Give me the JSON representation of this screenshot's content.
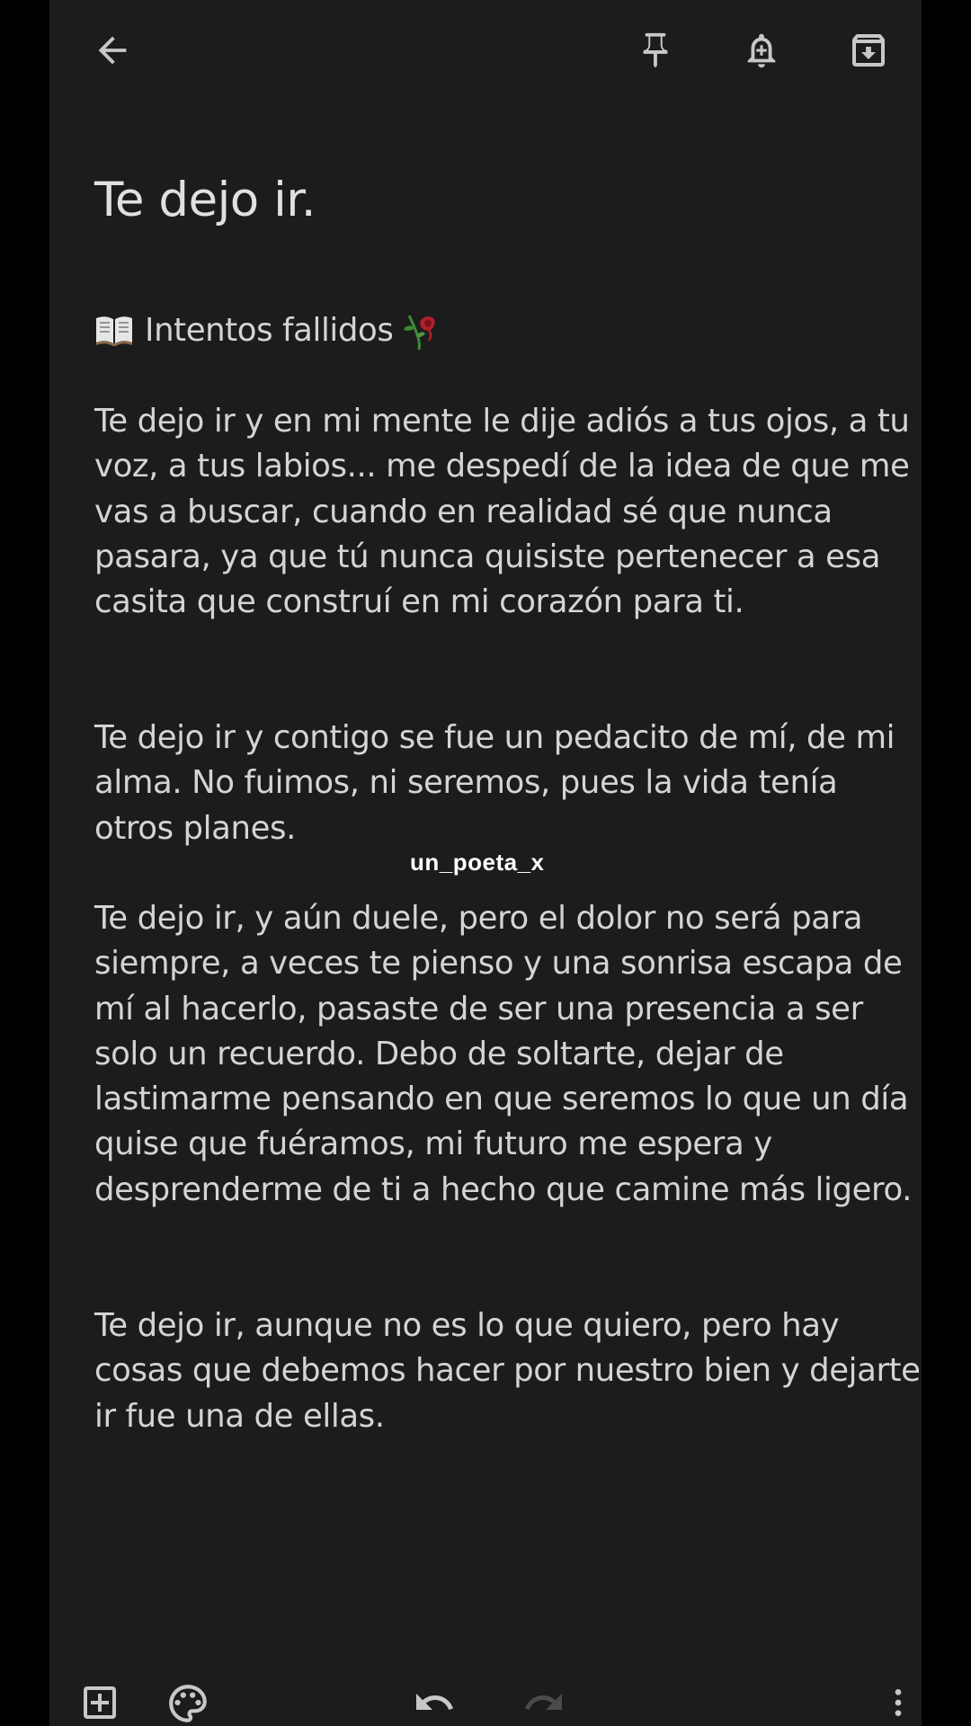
{
  "note": {
    "title": "Te dejo ir.",
    "subtitle": "Intentos fallidos",
    "paragraphs": [
      "Te dejo ir y en mi mente le dije adiós a tus ojos, a tu voz, a tus labios... me despedí de la idea de que me vas a buscar, cuando en realidad sé que nunca pasara, ya que tú nunca quisiste pertenecer a esa casita que construí en mi corazón para ti.",
      "Te dejo ir y contigo se fue un pedacito de mí, de mi alma. No fuimos, ni seremos, pues la vida tenía otros planes.",
      "Te dejo ir, y aún duele, pero el dolor no será para siempre, a veces te pienso y una sonrisa escapa de mí al hacerlo, pasaste de ser una presencia a ser solo un recuerdo. Debo de soltarte, dejar de lastimarme pensando en que seremos lo que un día quise que fuéramos, mi futuro me espera y desprenderme de ti a hecho que camine más ligero.",
      "Te dejo ir, aunque no es lo que quiero, pero hay cosas que debemos hacer por nuestro bien y dejarte ir fue una de ellas."
    ]
  },
  "watermark": "un_poeta_x",
  "icons": {
    "top": [
      "back-arrow-icon",
      "pin-icon",
      "reminder-bell-icon",
      "archive-icon"
    ],
    "bottom": [
      "add-box-icon",
      "palette-icon",
      "undo-icon",
      "redo-icon",
      "more-vert-icon"
    ],
    "subtitle_prefix": "open-book-emoji",
    "subtitle_suffix": "wilted-rose-emoji"
  },
  "colors": {
    "background": "#1c1c1c",
    "outer": "#000000",
    "text": "#d4d4d4",
    "icon": "#c8c8c8"
  }
}
